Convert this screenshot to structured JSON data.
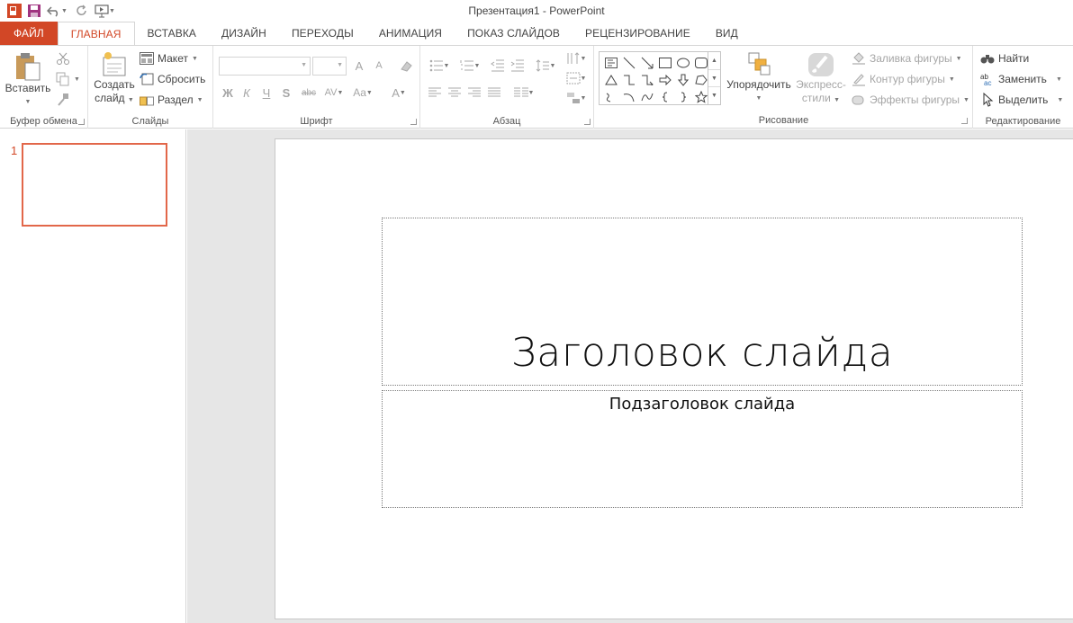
{
  "window": {
    "title": "Презентация1 - PowerPoint"
  },
  "tabs": [
    {
      "label": "ФАЙЛ"
    },
    {
      "label": "ГЛАВНАЯ"
    },
    {
      "label": "ВСТАВКА"
    },
    {
      "label": "ДИЗАЙН"
    },
    {
      "label": "ПЕРЕХОДЫ"
    },
    {
      "label": "АНИМАЦИЯ"
    },
    {
      "label": "ПОКАЗ СЛАЙДОВ"
    },
    {
      "label": "РЕЦЕНЗИРОВАНИЕ"
    },
    {
      "label": "ВИД"
    }
  ],
  "ribbon": {
    "clipboard": {
      "label": "Буфер обмена",
      "paste": "Вставить"
    },
    "slides": {
      "label": "Слайды",
      "new_slide_1": "Создать",
      "new_slide_2": "слайд",
      "layout": "Макет",
      "reset": "Сбросить",
      "section": "Раздел"
    },
    "font": {
      "label": "Шрифт",
      "bold": "Ж",
      "italic": "К",
      "underline": "Ч",
      "shadow": "S",
      "strike": "abc",
      "spacing": "AV",
      "case": "Aa",
      "color": "A",
      "grow": "A",
      "shrink": "A"
    },
    "paragraph": {
      "label": "Абзац"
    },
    "drawing": {
      "label": "Рисование",
      "arrange": "Упорядочить",
      "quick_styles_1": "Экспресс-",
      "quick_styles_2": "стили",
      "fill": "Заливка фигуры",
      "outline": "Контур фигуры",
      "effects": "Эффекты фигуры"
    },
    "editing": {
      "label": "Редактирование",
      "find": "Найти",
      "replace": "Заменить",
      "select": "Выделить"
    }
  },
  "thumbnails": {
    "slide_number": "1"
  },
  "slide": {
    "title": "Заголовок слайда",
    "subtitle": "Подзаголовок слайда"
  },
  "colors": {
    "accent": "#d24726",
    "thumb_border": "#e2674a"
  }
}
